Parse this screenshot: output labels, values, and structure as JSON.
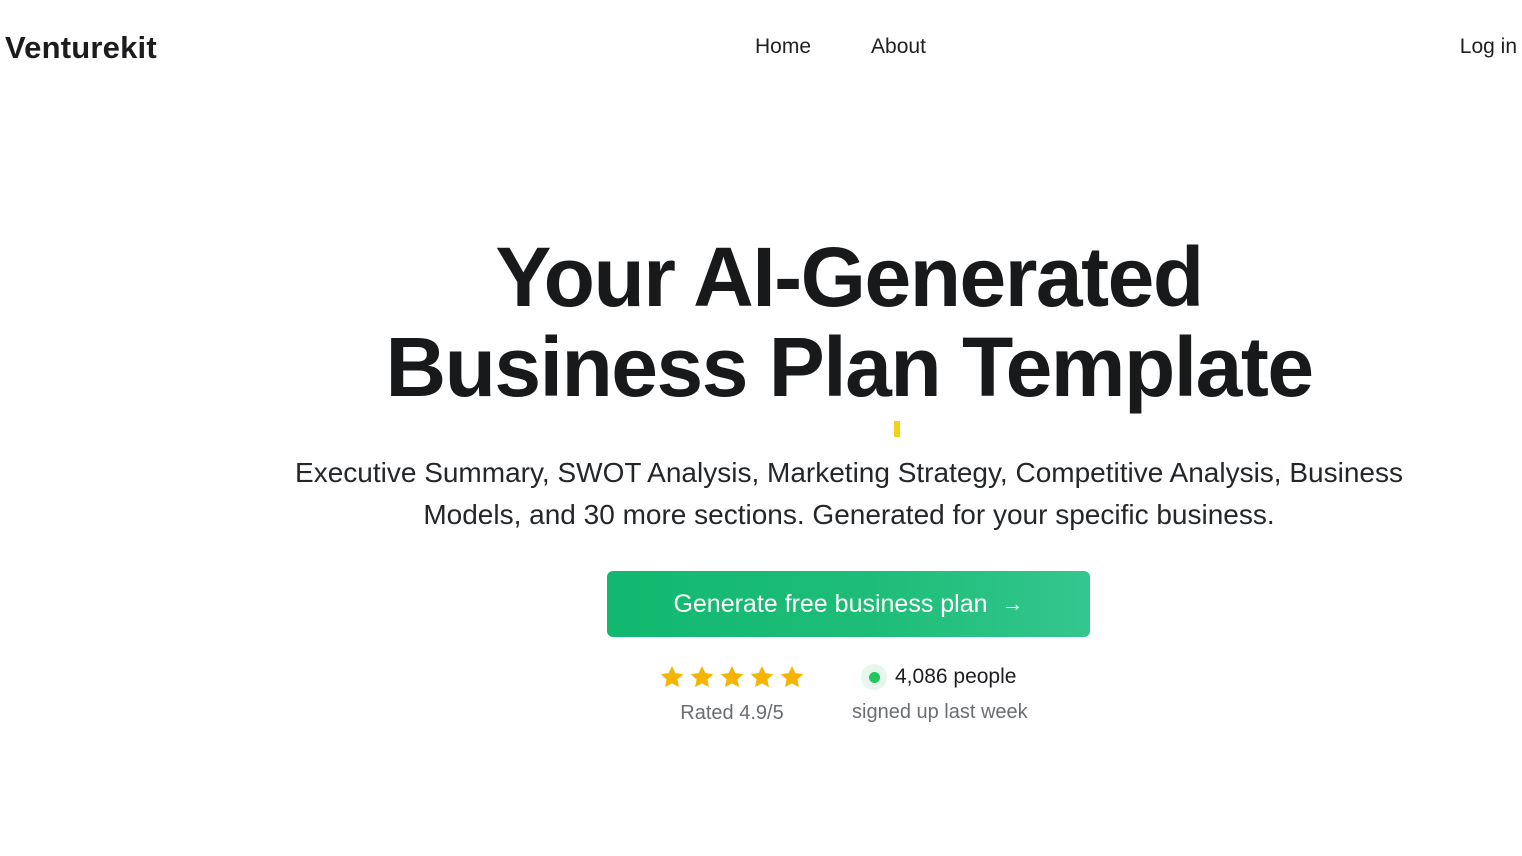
{
  "header": {
    "logo_text": "Venturekit",
    "nav": [
      {
        "label": "Home"
      },
      {
        "label": "About"
      }
    ],
    "login_label": "Log in"
  },
  "hero": {
    "headline_line1": "Your AI-Generated",
    "headline_line2": "Business Plan Template",
    "subtitle": "Executive Summary, SWOT Analysis, Marketing Strategy, Competitive Analysis, Business Models, and 30 more sections. Generated for your specific business.",
    "cta_label": "Generate free business plan",
    "cta_icon": "arrow-right-icon"
  },
  "social_proof": {
    "stars_filled": 5,
    "stars_total": 5,
    "rating_text": "Rated 4.9/5",
    "signup_count": "4,086 people",
    "signup_subtext": "signed up last week"
  },
  "colors": {
    "accent": "#12b86f",
    "star": "#f5b400",
    "live_dot": "#22c55e",
    "cursor_highlight": "#f2d214"
  }
}
